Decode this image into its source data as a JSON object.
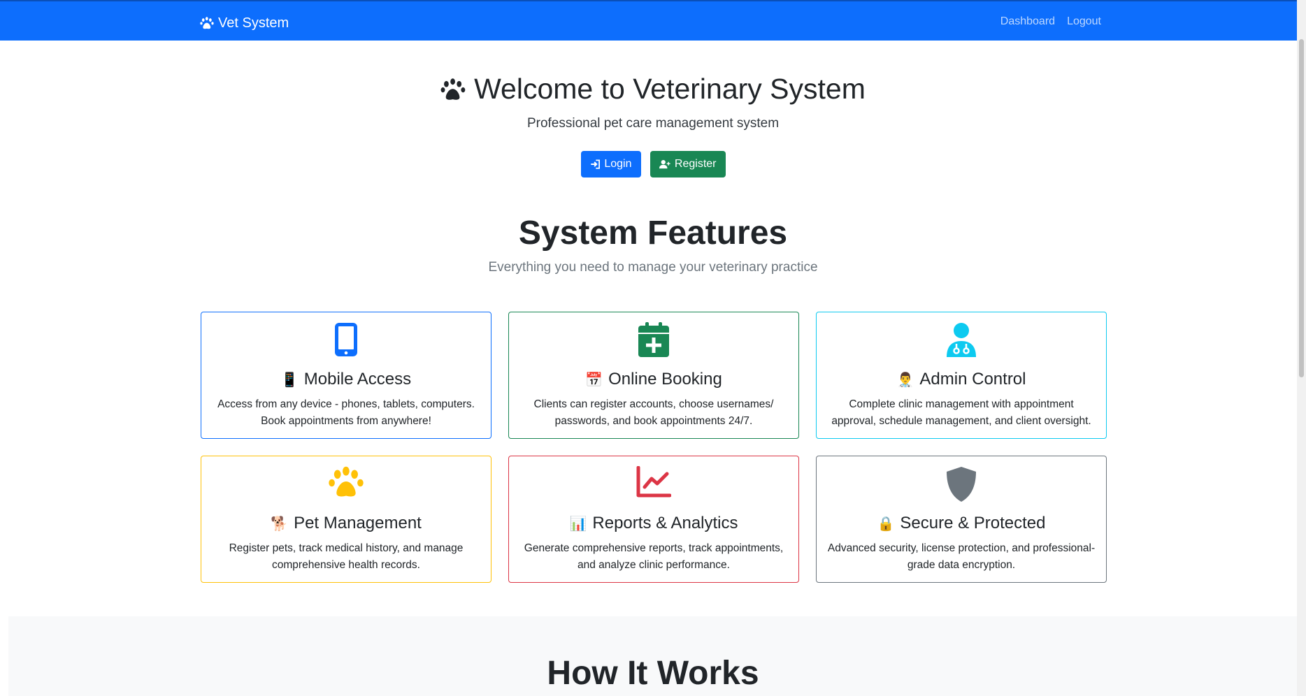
{
  "navbar": {
    "brand": "Vet System",
    "links": [
      "Dashboard",
      "Logout"
    ],
    "color": "#0d6efd"
  },
  "hero": {
    "title": "Welcome to Veterinary System",
    "subtitle": "Professional pet care management system",
    "login_label": "Login",
    "register_label": "Register"
  },
  "features": {
    "title": "System Features",
    "subtitle": "Everything you need to manage your veterinary practice",
    "cards": [
      {
        "emoji": "📱",
        "title": "Mobile Access",
        "text": "Access from any device - phones, tablets, computers. Book appointments from anywhere!",
        "icon": "mobile-icon",
        "color": "#0d6efd"
      },
      {
        "emoji": "📅",
        "title": "Online Booking",
        "text": "Clients can register accounts, choose usernames/ passwords, and book appointments 24/7.",
        "icon": "calendar-plus-icon",
        "color": "#198754"
      },
      {
        "emoji": "👨‍⚕️",
        "title": "Admin Control",
        "text": "Complete clinic management with appointment approval, schedule management, and client oversight.",
        "icon": "user-doctor-icon",
        "color": "#0dcaf0"
      },
      {
        "emoji": "🐕",
        "title": "Pet Management",
        "text": "Register pets, track medical history, and manage comprehensive health records.",
        "icon": "paw-icon",
        "color": "#ffc107"
      },
      {
        "emoji": "📊",
        "title": "Reports & Analytics",
        "text": "Generate comprehensive reports, track appointments, and analyze clinic performance.",
        "icon": "chart-line-icon",
        "color": "#dc3545"
      },
      {
        "emoji": "🔒",
        "title": "Secure & Protected",
        "text": "Advanced security, license protection, and professional-grade data encryption.",
        "icon": "shield-icon",
        "color": "#6c757d"
      }
    ]
  },
  "how": {
    "title": "How It Works"
  }
}
